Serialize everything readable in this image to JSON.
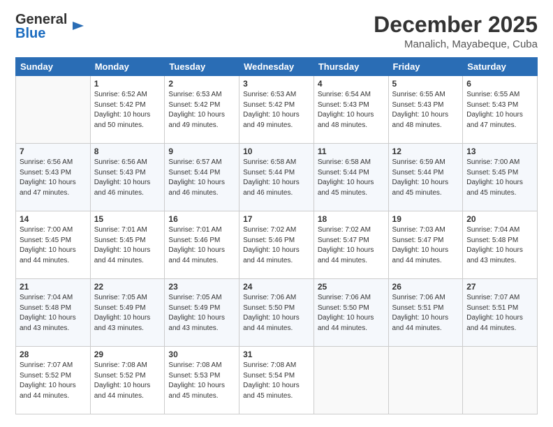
{
  "header": {
    "logo_general": "General",
    "logo_blue": "Blue",
    "month": "December 2025",
    "location": "Manalich, Mayabeque, Cuba"
  },
  "weekdays": [
    "Sunday",
    "Monday",
    "Tuesday",
    "Wednesday",
    "Thursday",
    "Friday",
    "Saturday"
  ],
  "weeks": [
    [
      {
        "day": "",
        "info": ""
      },
      {
        "day": "1",
        "info": "Sunrise: 6:52 AM\nSunset: 5:42 PM\nDaylight: 10 hours\nand 50 minutes."
      },
      {
        "day": "2",
        "info": "Sunrise: 6:53 AM\nSunset: 5:42 PM\nDaylight: 10 hours\nand 49 minutes."
      },
      {
        "day": "3",
        "info": "Sunrise: 6:53 AM\nSunset: 5:42 PM\nDaylight: 10 hours\nand 49 minutes."
      },
      {
        "day": "4",
        "info": "Sunrise: 6:54 AM\nSunset: 5:43 PM\nDaylight: 10 hours\nand 48 minutes."
      },
      {
        "day": "5",
        "info": "Sunrise: 6:55 AM\nSunset: 5:43 PM\nDaylight: 10 hours\nand 48 minutes."
      },
      {
        "day": "6",
        "info": "Sunrise: 6:55 AM\nSunset: 5:43 PM\nDaylight: 10 hours\nand 47 minutes."
      }
    ],
    [
      {
        "day": "7",
        "info": "Sunrise: 6:56 AM\nSunset: 5:43 PM\nDaylight: 10 hours\nand 47 minutes."
      },
      {
        "day": "8",
        "info": "Sunrise: 6:56 AM\nSunset: 5:43 PM\nDaylight: 10 hours\nand 46 minutes."
      },
      {
        "day": "9",
        "info": "Sunrise: 6:57 AM\nSunset: 5:44 PM\nDaylight: 10 hours\nand 46 minutes."
      },
      {
        "day": "10",
        "info": "Sunrise: 6:58 AM\nSunset: 5:44 PM\nDaylight: 10 hours\nand 46 minutes."
      },
      {
        "day": "11",
        "info": "Sunrise: 6:58 AM\nSunset: 5:44 PM\nDaylight: 10 hours\nand 45 minutes."
      },
      {
        "day": "12",
        "info": "Sunrise: 6:59 AM\nSunset: 5:44 PM\nDaylight: 10 hours\nand 45 minutes."
      },
      {
        "day": "13",
        "info": "Sunrise: 7:00 AM\nSunset: 5:45 PM\nDaylight: 10 hours\nand 45 minutes."
      }
    ],
    [
      {
        "day": "14",
        "info": "Sunrise: 7:00 AM\nSunset: 5:45 PM\nDaylight: 10 hours\nand 44 minutes."
      },
      {
        "day": "15",
        "info": "Sunrise: 7:01 AM\nSunset: 5:45 PM\nDaylight: 10 hours\nand 44 minutes."
      },
      {
        "day": "16",
        "info": "Sunrise: 7:01 AM\nSunset: 5:46 PM\nDaylight: 10 hours\nand 44 minutes."
      },
      {
        "day": "17",
        "info": "Sunrise: 7:02 AM\nSunset: 5:46 PM\nDaylight: 10 hours\nand 44 minutes."
      },
      {
        "day": "18",
        "info": "Sunrise: 7:02 AM\nSunset: 5:47 PM\nDaylight: 10 hours\nand 44 minutes."
      },
      {
        "day": "19",
        "info": "Sunrise: 7:03 AM\nSunset: 5:47 PM\nDaylight: 10 hours\nand 44 minutes."
      },
      {
        "day": "20",
        "info": "Sunrise: 7:04 AM\nSunset: 5:48 PM\nDaylight: 10 hours\nand 43 minutes."
      }
    ],
    [
      {
        "day": "21",
        "info": "Sunrise: 7:04 AM\nSunset: 5:48 PM\nDaylight: 10 hours\nand 43 minutes."
      },
      {
        "day": "22",
        "info": "Sunrise: 7:05 AM\nSunset: 5:49 PM\nDaylight: 10 hours\nand 43 minutes."
      },
      {
        "day": "23",
        "info": "Sunrise: 7:05 AM\nSunset: 5:49 PM\nDaylight: 10 hours\nand 43 minutes."
      },
      {
        "day": "24",
        "info": "Sunrise: 7:06 AM\nSunset: 5:50 PM\nDaylight: 10 hours\nand 44 minutes."
      },
      {
        "day": "25",
        "info": "Sunrise: 7:06 AM\nSunset: 5:50 PM\nDaylight: 10 hours\nand 44 minutes."
      },
      {
        "day": "26",
        "info": "Sunrise: 7:06 AM\nSunset: 5:51 PM\nDaylight: 10 hours\nand 44 minutes."
      },
      {
        "day": "27",
        "info": "Sunrise: 7:07 AM\nSunset: 5:51 PM\nDaylight: 10 hours\nand 44 minutes."
      }
    ],
    [
      {
        "day": "28",
        "info": "Sunrise: 7:07 AM\nSunset: 5:52 PM\nDaylight: 10 hours\nand 44 minutes."
      },
      {
        "day": "29",
        "info": "Sunrise: 7:08 AM\nSunset: 5:52 PM\nDaylight: 10 hours\nand 44 minutes."
      },
      {
        "day": "30",
        "info": "Sunrise: 7:08 AM\nSunset: 5:53 PM\nDaylight: 10 hours\nand 45 minutes."
      },
      {
        "day": "31",
        "info": "Sunrise: 7:08 AM\nSunset: 5:54 PM\nDaylight: 10 hours\nand 45 minutes."
      },
      {
        "day": "",
        "info": ""
      },
      {
        "day": "",
        "info": ""
      },
      {
        "day": "",
        "info": ""
      }
    ]
  ]
}
